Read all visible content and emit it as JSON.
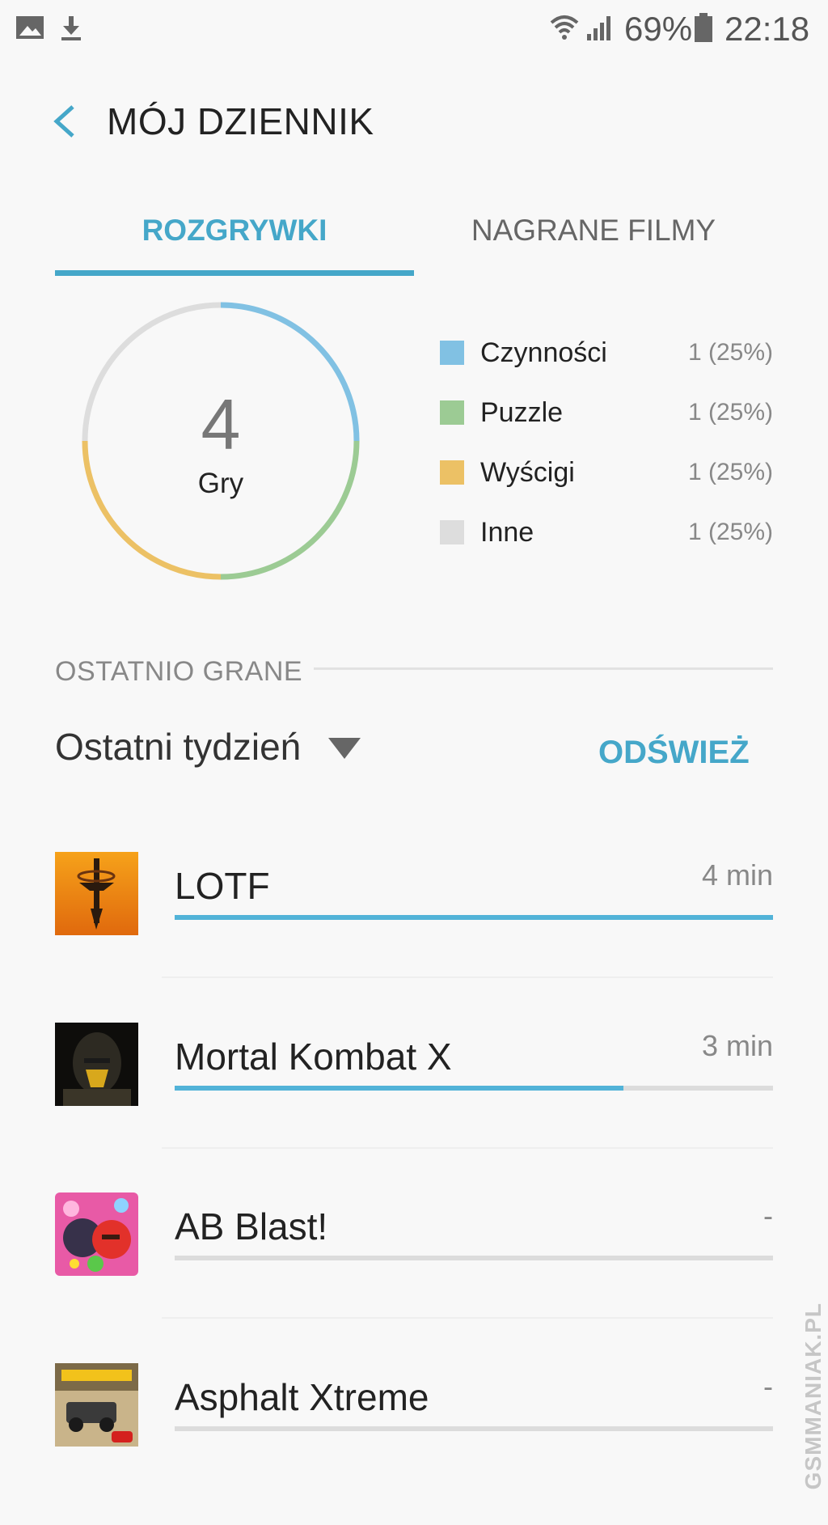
{
  "status_bar": {
    "icons_left": [
      "gallery-icon",
      "download-icon"
    ],
    "icons_right": [
      "wifi-icon",
      "signal-icon",
      "battery-icon"
    ],
    "battery": "69%",
    "time": "22:18"
  },
  "header": {
    "back_icon": "chevron-left-icon",
    "title": "MÓJ DZIENNIK"
  },
  "tabs": [
    {
      "label": "ROZGRYWKI",
      "active": true
    },
    {
      "label": "NAGRANE FILMY",
      "active": false
    }
  ],
  "colors": {
    "accent": "#45a7c9",
    "czynnosci": "#81c1e3",
    "puzzle": "#9ccb94",
    "wyscigi": "#ecc165",
    "inne": "#dddddd"
  },
  "summary": {
    "count": "4",
    "label": "Gry"
  },
  "chart_data": {
    "type": "pie",
    "categories": [
      "Czynności",
      "Puzzle",
      "Wyścigi",
      "Inne"
    ],
    "values": [
      1,
      1,
      1,
      1
    ],
    "value_labels": [
      "1 (25%)",
      "1 (25%)",
      "1 (25%)",
      "1 (25%)"
    ],
    "colors": [
      "#81c1e3",
      "#9ccb94",
      "#ecc165",
      "#dddddd"
    ],
    "center_value": "4",
    "center_label": "Gry"
  },
  "legend": [
    {
      "label": "Czynności",
      "value": "1 (25%)",
      "color": "#81c1e3"
    },
    {
      "label": "Puzzle",
      "value": "1 (25%)",
      "color": "#9ccb94"
    },
    {
      "label": "Wyścigi",
      "value": "1 (25%)",
      "color": "#ecc165"
    },
    {
      "label": "Inne",
      "value": "1 (25%)",
      "color": "#dddddd"
    }
  ],
  "recent": {
    "section_title": "OSTATNIO GRANE",
    "period": "Ostatni tydzień",
    "refresh_label": "ODŚWIEŻ"
  },
  "games": [
    {
      "name": "LOTF",
      "time": "4 min",
      "progress": 1.0,
      "icon": "lotf-icon"
    },
    {
      "name": "Mortal Kombat X",
      "time": "3 min",
      "progress": 0.75,
      "icon": "mortal-kombat-icon"
    },
    {
      "name": "AB Blast!",
      "time": "-",
      "progress": 0,
      "icon": "ab-blast-icon"
    },
    {
      "name": "Asphalt Xtreme",
      "time": "-",
      "progress": 0,
      "icon": "asphalt-xtreme-icon"
    }
  ],
  "watermark": "GSMMANIAK.PL"
}
